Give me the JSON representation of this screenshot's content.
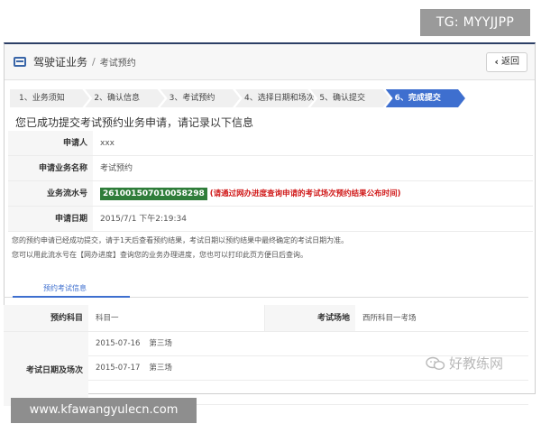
{
  "overlay": {
    "top_tag": "TG: MYYJJPP",
    "bottom_url": "www.kfawangyulecn.com",
    "watermark": "好教练网"
  },
  "header": {
    "breadcrumb_main": "驾驶证业务",
    "breadcrumb_sep": "/",
    "breadcrumb_sub": "考试预约",
    "back_label": "返回"
  },
  "steps": [
    {
      "label": "1、业务须知"
    },
    {
      "label": "2、确认信息"
    },
    {
      "label": "3、考试预约"
    },
    {
      "label": "4、选择日期和场次"
    },
    {
      "label": "5、确认提交"
    },
    {
      "label": "6、完成提交"
    }
  ],
  "notice_title": "您已成功提交考试预约业务申请，请记录以下信息",
  "info": {
    "applicant_label": "申请人",
    "applicant_value": "xxx",
    "business_label": "申请业务名称",
    "business_value": "考试预约",
    "serial_label": "业务流水号",
    "serial_value": "261001507010058298",
    "serial_note": "(请通过网办进度查询申请的考试场次预约结果公布时间)",
    "date_label": "申请日期",
    "date_value": "2015/7/1 下午2:19:34"
  },
  "tips": {
    "line1": "您的预约申请已经成功提交，请于1天后查看预约结果，考试日期以预约结果中最终确定的考试日期为准。",
    "line2": "您可以用此流水号在【网办进度】查询您的业务办理进度，您也可以打印此页方便日后查询。"
  },
  "exam": {
    "tab_label": "预约考试信息",
    "subject_label": "预约科目",
    "subject_value": "科目一",
    "venue_label": "考试场地",
    "venue_value": "西所科目一考场",
    "dates_label": "考试日期及场次",
    "dates": [
      {
        "date": "2015-07-16",
        "session": "第三场"
      },
      {
        "date": "2015-07-17",
        "session": "第三场"
      },
      {
        "date": "",
        "session": ""
      }
    ]
  }
}
